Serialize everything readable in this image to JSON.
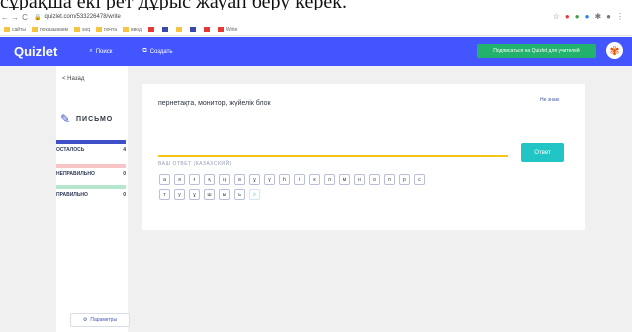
{
  "caption": "сұрақша екі рет дұрыс жауап беру керек.",
  "browser": {
    "url": "quizlet.com/533226478/write",
    "bookmarks": [
      "сайты",
      "показываем",
      "soq",
      "почта",
      "ввод",
      "",
      "",
      "",
      "",
      "",
      "",
      "",
      "Write"
    ]
  },
  "header": {
    "logo": "Quizlet",
    "search": "Поиск",
    "create": "Создать",
    "subscribe": "Подписаться на Quizlet для учителей"
  },
  "sidebar": {
    "back": "< Назад",
    "mode_title": "ПИСЬМО",
    "stats": [
      {
        "label": "ОСТАЛОСЬ",
        "value": "4",
        "color": "#3f4fc9"
      },
      {
        "label": "НЕПРАВИЛЬНО",
        "value": "0",
        "color": "#f7c5c5"
      },
      {
        "label": "ПРАВИЛЬНО",
        "value": "0",
        "color": "#b7e6cf"
      }
    ],
    "options": "Параметры"
  },
  "question": {
    "prompt": "пернетақта, монитор, жүйелік блок",
    "dont_know": "Не знаю",
    "answer_value": "",
    "answer_label": "ВАШ ОТВЕТ (КАЗАХСКИЙ)",
    "submit": "Ответ"
  },
  "keyboard": [
    "а",
    "ә",
    "ғ",
    "қ",
    "ң",
    "ө",
    "ұ",
    "ү",
    "һ",
    "і",
    "к",
    "л",
    "м",
    "н",
    "о",
    "п",
    "р",
    "с",
    "т",
    "у",
    "ұ",
    "ш",
    "ы",
    "ь",
    "ё"
  ],
  "colors": {
    "brand": "#4255ff",
    "subscribe": "#23b26d",
    "submit": "#22c5c5",
    "input_underline": "#f5c518"
  }
}
